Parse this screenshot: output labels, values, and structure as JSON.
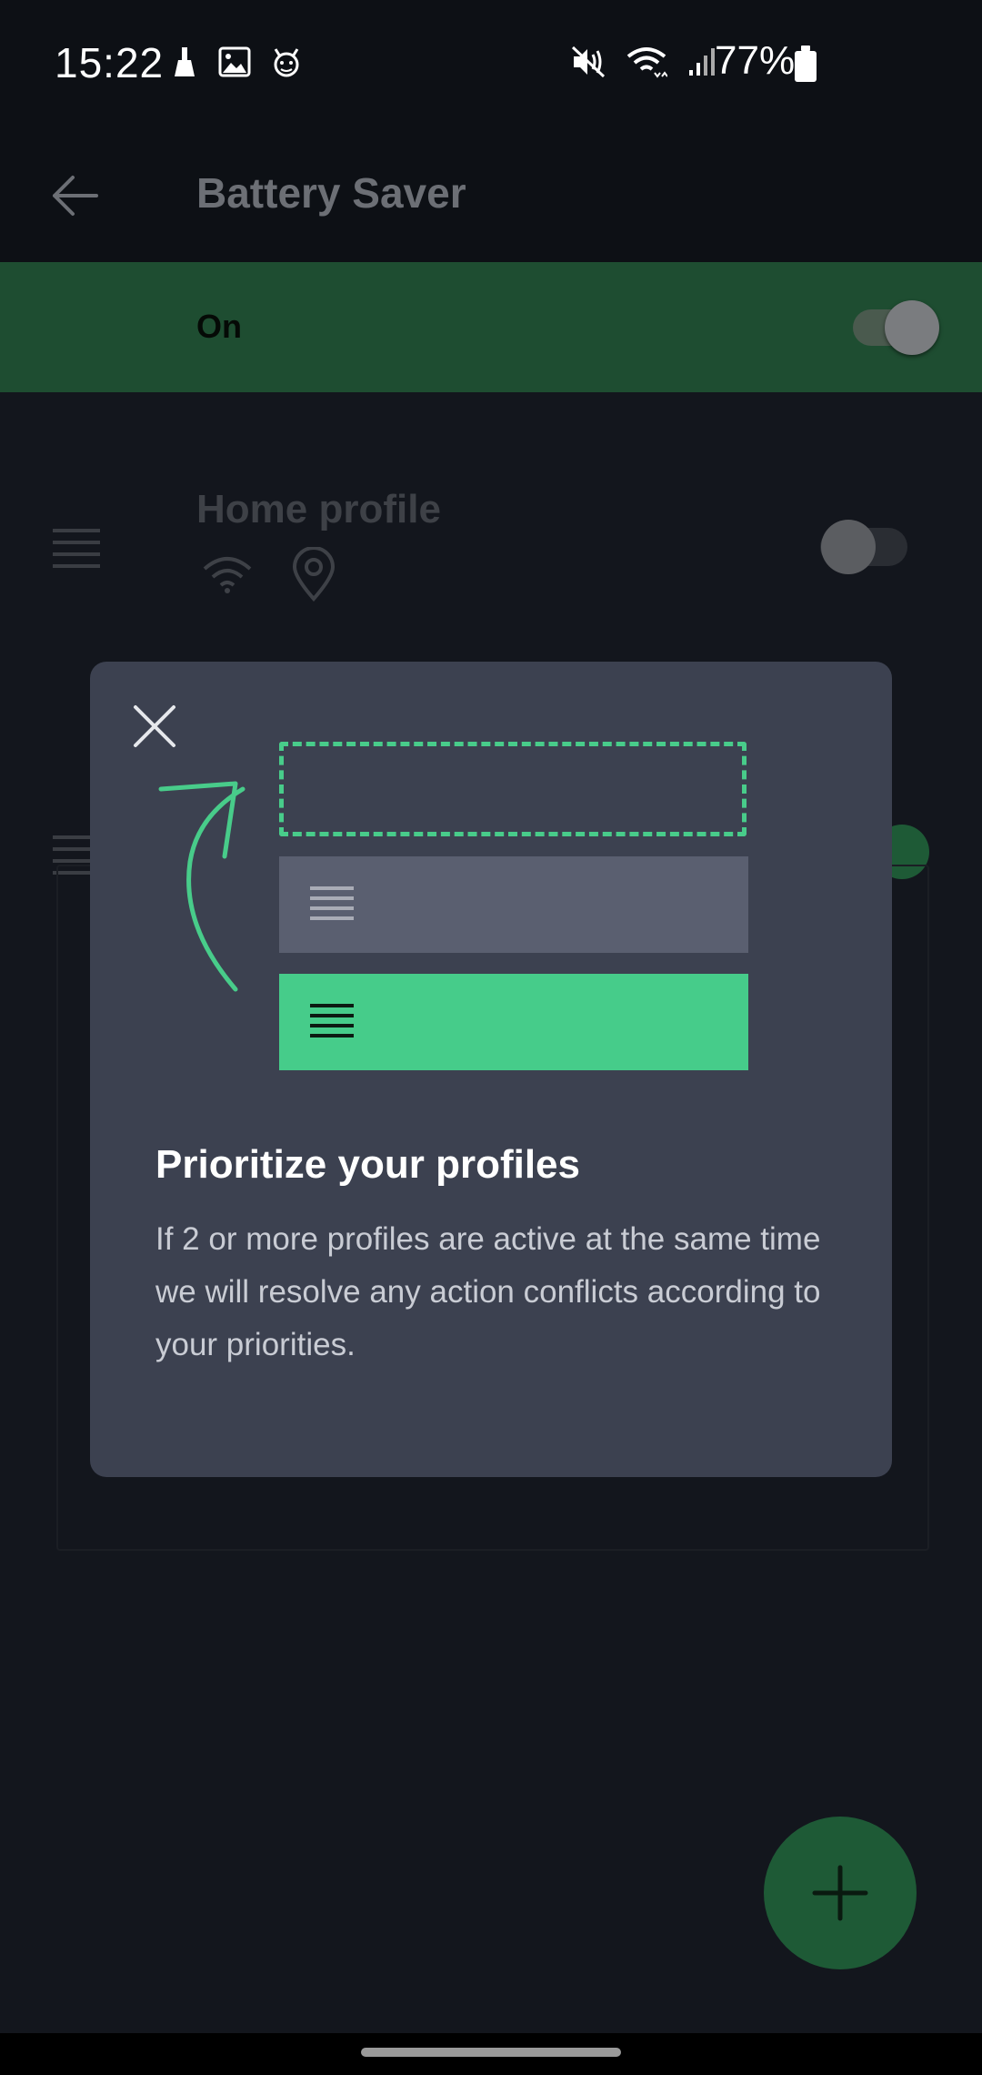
{
  "status_bar": {
    "time": "15:22",
    "battery_percent": "77%",
    "left_icons": [
      "cleaner-icon",
      "gallery-icon",
      "mascot-icon"
    ],
    "right_icons": [
      "mute-icon",
      "wifi-icon",
      "signal-icon",
      "battery-icon"
    ]
  },
  "app_bar": {
    "title": "Battery Saver",
    "back_icon": "arrow-left-icon"
  },
  "master_switch": {
    "label": "On",
    "checked": true
  },
  "profiles": [
    {
      "name": "Home profile",
      "icons": [
        "wifi-icon",
        "location-pin-icon"
      ],
      "enabled": false
    },
    {
      "name": "",
      "icons": [],
      "enabled": true
    }
  ],
  "dialog": {
    "title": "Prioritize your profiles",
    "body": "If 2 or more profiles are active at the same time we will resolve any action conflicts according to your priorities.",
    "close_icon": "close-icon"
  },
  "fab": {
    "icon": "plus-icon"
  },
  "colors": {
    "accent_green": "#46cc8a",
    "master_row_bg": "#1e4d31",
    "dialog_bg": "#3c4150",
    "app_bg": "#13161d"
  }
}
